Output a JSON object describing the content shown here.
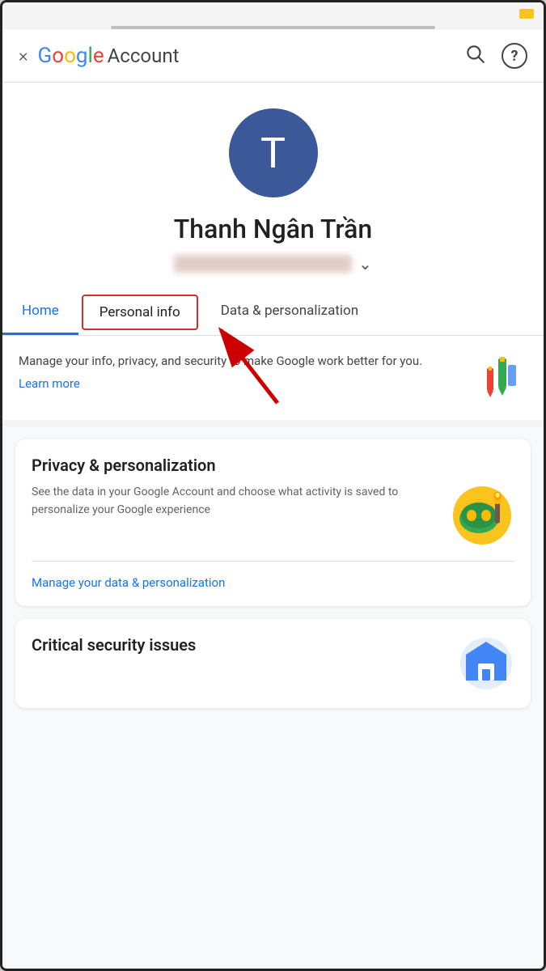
{
  "statusBar": {
    "indicator": "yellow"
  },
  "header": {
    "close_label": "×",
    "google_letters": [
      "G",
      "o",
      "o",
      "g",
      "l",
      "e"
    ],
    "title": "Account",
    "search_tooltip": "Search",
    "help_tooltip": "Help"
  },
  "profile": {
    "avatar_letter": "T",
    "name": "Thanh Ngân Trần",
    "email_placeholder": "blurred email"
  },
  "tabs": {
    "items": [
      {
        "id": "home",
        "label": "Home",
        "active": true
      },
      {
        "id": "personal_info",
        "label": "Personal info",
        "highlighted": true
      },
      {
        "id": "data_personalization",
        "label": "Data & personalization"
      }
    ]
  },
  "infoBanner": {
    "text": "Manage your info, privacy, and security to make Google work better for you.",
    "learn_more": "Learn more"
  },
  "privacyCard": {
    "title": "Privacy & personalization",
    "text": "See the data in your Google Account and choose what activity is saved to personalize your Google experience",
    "link": "Manage your data & personalization"
  },
  "securityCard": {
    "title": "Critical security issues"
  }
}
